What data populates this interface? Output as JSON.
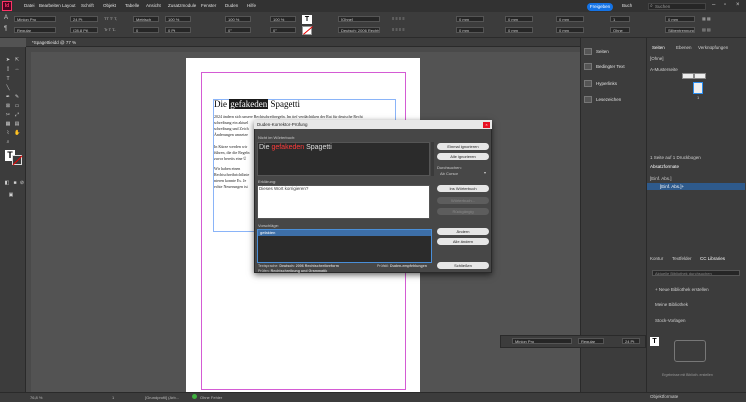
{
  "app": {
    "logo": "Id",
    "menus": [
      "Datei",
      "Bearbeiten",
      "Layout",
      "Schrift",
      "Objekt",
      "Tabelle",
      "Ansicht",
      "Zusatzmodule",
      "Fenster",
      "Duden",
      "Hilfe"
    ],
    "share_label": "Freigeben",
    "user_label": "Buch",
    "search_placeholder": "Suchen"
  },
  "control_bar": {
    "font": "Minion Pro",
    "style": "Regular",
    "size": "24 Pt",
    "leading": "(28,8 Pt)",
    "tracking": "0",
    "kerning": "Metrisch",
    "hscale": "100 %",
    "vscale": "100 %",
    "baseline": "0 Pt",
    "skew": "0°",
    "char_style": "[Ohne]",
    "language": "Deutsch: 2006 Rechtschreibung",
    "indent1": "0 mm",
    "indent2": "0 mm",
    "indent3": "0 mm",
    "indent4": "0 mm",
    "auto_label": "Ohne",
    "columns": "1",
    "hyph": "Silbentrennung"
  },
  "document": {
    "tab_title": "*Spagettieidd @ 77 %",
    "headline_before": "Die ",
    "headline_word": "gefakeden",
    "headline_after": " Spagetti",
    "body_lines": [
      "2024 ändern sich unsere Rechtschreibregeln. Im tief verdächtiken der Rat für deutsche Recht",
      "schreibung ein aktuel",
      "schreibung und Zeich",
      "Änderungen umsetze",
      "",
      "In Kürze werden wir",
      "führen, die die Regeln",
      "zuvor bereits eine Ü",
      "",
      "    Wir haben einen",
      "Rechtschreibrichtlinie",
      "nieren konnte Es. Je",
      "echte Neuerungen ist"
    ]
  },
  "status_bar": {
    "zoom": "76,8 %",
    "page": "1",
    "prefs": "[Grundprofil] (Arb...",
    "errors": "Ohne Fehler"
  },
  "mid_panel": {
    "items": [
      "Seiten",
      "Bedingter Text",
      "Hyperlinks",
      "Lesezeichen"
    ]
  },
  "right_panel": {
    "tabs": [
      "Seiten",
      "Ebenen",
      "Verknüpfungen"
    ],
    "none_label": "[Ohne]",
    "master_label": "A-Musterseite",
    "styles_tabs": [
      "Absatzformate"
    ],
    "style_list": [
      "[Einf. Abs.]",
      "[Einf. Abs.]+"
    ],
    "status_line": "1 Seite auf 1 Druckbogen",
    "lib_tabs": [
      "Kontur",
      "Textfelder",
      "CC Libraries"
    ],
    "lib_search": "Aktuelle Bibliothek durchsuchen",
    "lib_new": "+ Neue Bibliothek erstellen",
    "lib_items": [
      "Meine Bibliothek",
      "Stock-Vorlagen"
    ],
    "lib_empty": "Ergebnisse mit Biblioth. erstellen",
    "bottom_label": "Objektformate"
  },
  "char_panel": {
    "font": "Minion Pro",
    "style": "Regular",
    "size": "24 Pt"
  },
  "dialog": {
    "title": "Duden-Korrektor-Prüfung",
    "not_in_dict_label": "Nicht im Wörterbuch:",
    "sentence_before": "Die ",
    "sentence_word": "gefakeden",
    "sentence_after": " Spagetti",
    "btn_ignore_once": "Einmal ignorieren",
    "btn_ignore_all": "Alle ignorieren",
    "search_label": "Durchsuchen:",
    "search_value": "Ab Cursor",
    "btn_to_dict": "Ins Wörterbuch",
    "btn_dict": "Wörterbuch...",
    "btn_undo": "Rückgängig",
    "explanation_label": "Erklärung:",
    "explanation_text": "Dieses Wort korrigieren?",
    "suggestions_label": "Vorschläge:",
    "suggestions": [
      "gefakten"
    ],
    "btn_change": "Ändern",
    "btn_change_all": "Alle ändern",
    "btn_close": "Schließen",
    "footer_lang_label": "Textsprache:",
    "footer_lang_value": "Deutsch: 2006 Rechtschreibreform",
    "footer_check_label": "Prüfen:",
    "footer_check_value": "Rechtschreibung und Grammatik",
    "footer_profile_label": "Prüfstil:",
    "footer_profile_value": "Duden-empfehlungen"
  },
  "colors": {
    "accent": "#1473e6",
    "error_red": "#ff3b3b",
    "margin_magenta": "#d45bd4",
    "frame_blue": "#8ab4f8"
  }
}
